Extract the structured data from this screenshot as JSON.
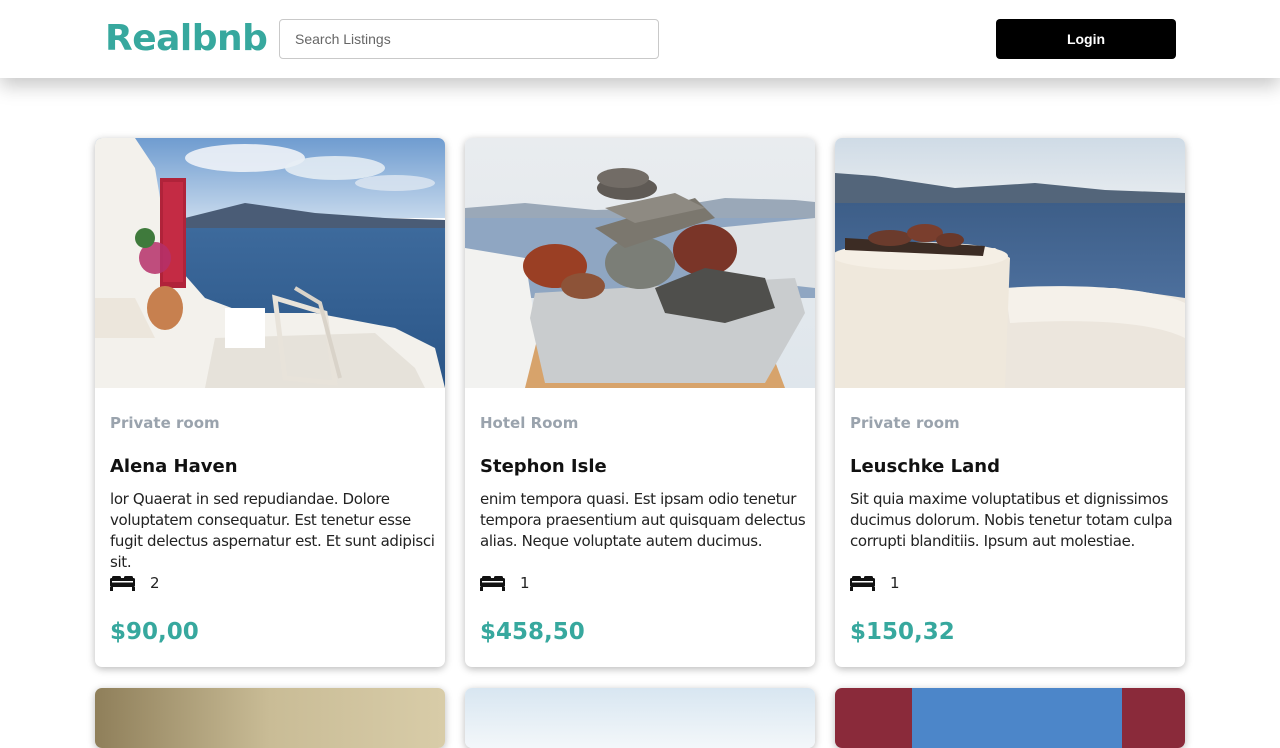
{
  "header": {
    "logo": "Realbnb",
    "search_placeholder": "Search Listings",
    "login_label": "Login"
  },
  "listings": [
    {
      "room_type": "Private room",
      "name": "Alena Haven",
      "description": "lor Quaerat in sed repudiandae. Dolore voluptatem consequatur. Est tenetur esse fugit delectus aspernatur est. Et sunt adipisci sit.",
      "beds": "2",
      "price": "$90,00",
      "bed_icon": "bed-icon"
    },
    {
      "room_type": "Hotel Room",
      "name": "Stephon Isle",
      "description": "enim tempora quasi. Est ipsam odio tenetur tempora praesentium aut quisquam delectus alias. Neque voluptate autem ducimus.",
      "beds": "1",
      "price": "$458,50",
      "bed_icon": "bed-icon"
    },
    {
      "room_type": "Private room",
      "name": "Leuschke Land",
      "description": "Sit quia maxime voluptatibus et dignissimos ducimus dolorum. Nobis tenetur totam culpa corrupti blanditiis. Ipsum aut molestiae.",
      "beds": "1",
      "price": "$150,32",
      "bed_icon": "bed-icon"
    }
  ],
  "colors": {
    "brand": "#37a89e",
    "muted": "#9aa3ad",
    "button": "#000000"
  }
}
